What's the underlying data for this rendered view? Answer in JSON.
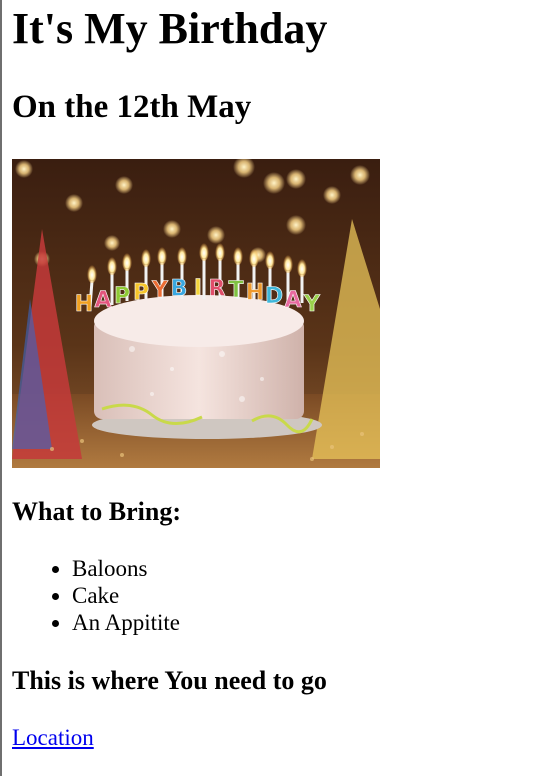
{
  "page": {
    "title": "It's My Birthday",
    "subtitle": "On the 12th May"
  },
  "image": {
    "cake_text": "HAPPY BIRTHDAY",
    "colors": {
      "background": "#3a1e10",
      "bokeh": "#ffd98a",
      "cake": "#f1dcd6",
      "plate": "#cfc7c1",
      "table": "#8a5a30"
    },
    "letter_colors": [
      "#f0a020",
      "#e4557d",
      "#8fca35",
      "#f6c52a",
      "#ec6d34",
      "#3aa7e0",
      "#f5d53a",
      "#e04e6a",
      "#7fc242",
      "#ef9a2e",
      "#3fb6d9",
      "#e86aa0",
      "#9ad14b",
      "#f2b23c"
    ]
  },
  "bring": {
    "heading": "What to Bring:",
    "items": [
      "Baloons",
      "Cake",
      "An Appitite"
    ]
  },
  "directions": {
    "heading": "This is where You need to go",
    "link_label": "Location"
  }
}
